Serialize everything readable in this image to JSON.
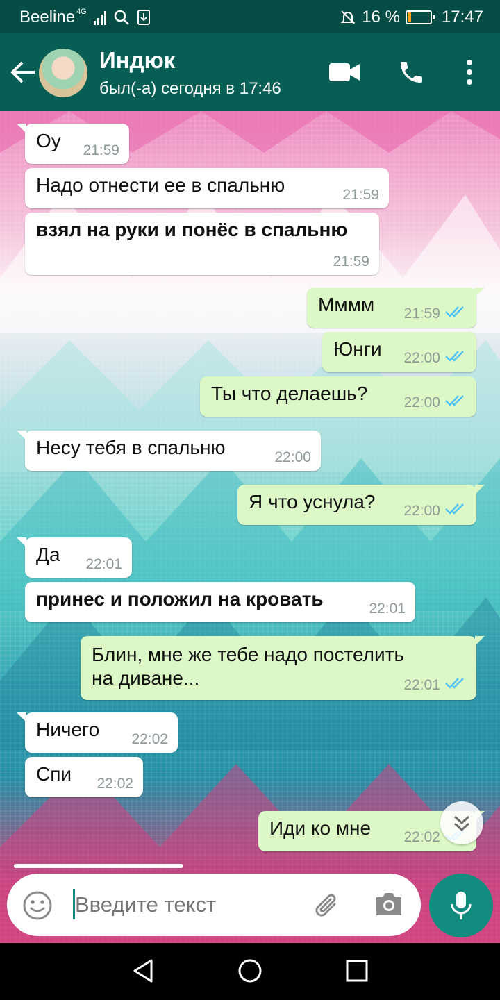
{
  "status_bar": {
    "carrier": "Beeline",
    "network": "4G",
    "battery": "16 %",
    "battery_level": 0.16,
    "time": "17:47"
  },
  "header": {
    "contact_name": "Индюк",
    "last_seen": "был(-а) сегодня в 17:46",
    "icons": [
      "back-arrow-icon",
      "video-call-icon",
      "phone-icon",
      "more-vert-icon"
    ]
  },
  "messages": [
    {
      "dir": "in",
      "text": "Оу",
      "time": "21:59"
    },
    {
      "dir": "in",
      "text": "Надо отнести ее в спальню",
      "time": "21:59"
    },
    {
      "dir": "in",
      "text": "взял на руки и понёс в спальню",
      "time": "21:59",
      "bold": true
    },
    {
      "dir": "out",
      "text": "Мммм",
      "time": "21:59",
      "ticks": "read"
    },
    {
      "dir": "out",
      "text": "Юнги",
      "time": "22:00",
      "ticks": "read"
    },
    {
      "dir": "out",
      "text": "Ты что делаешь?",
      "time": "22:00",
      "ticks": "read"
    },
    {
      "dir": "in",
      "text": "Несу тебя в спальню",
      "time": "22:00"
    },
    {
      "dir": "out",
      "text": "Я что уснула?",
      "time": "22:00",
      "ticks": "read"
    },
    {
      "dir": "in",
      "text": "Да",
      "time": "22:01"
    },
    {
      "dir": "in",
      "text": "принес и положил на кровать",
      "time": "22:01",
      "bold": true
    },
    {
      "dir": "out",
      "text": "Блин, мне же тебе надо постелить\nна диване...",
      "time": "22:01",
      "ticks": "read"
    },
    {
      "dir": "in",
      "text": "Ничего",
      "time": "22:02"
    },
    {
      "dir": "in",
      "text": "Спи",
      "time": "22:02"
    },
    {
      "dir": "out",
      "text": "Иди ко мне",
      "time": "22:02",
      "ticks": "read"
    }
  ],
  "composer": {
    "placeholder": "Введите текст",
    "icons": [
      "emoji-icon",
      "attach-icon",
      "camera-icon",
      "mic-icon"
    ]
  },
  "colors": {
    "header": "#075e54",
    "status_bar": "#054d44",
    "outgoing_bubble": "#dcf8c6",
    "incoming_bubble": "#ffffff",
    "read_ticks": "#4fc3f7",
    "accent": "#128c7e"
  }
}
